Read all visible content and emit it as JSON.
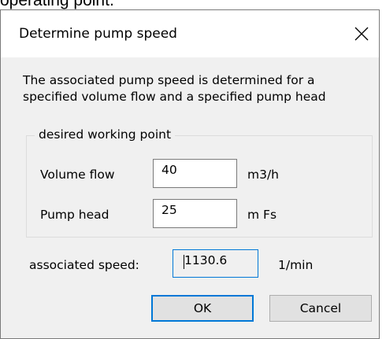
{
  "background_caption": "operating point.",
  "dialog": {
    "title": "Determine pump speed",
    "close_glyph": "close-x-icon",
    "description_line1": "The associated pump speed is determined for a",
    "description_line2": "specified volume flow and a specified pump head",
    "group": {
      "legend": "desired working point",
      "volume_flow": {
        "label": "Volume flow",
        "value": "40",
        "unit": "m3/h"
      },
      "pump_head": {
        "label": "Pump head",
        "value": "25",
        "unit": "m Fs"
      }
    },
    "speed": {
      "label": "associated speed:",
      "value": "1130.6",
      "unit": "1/min"
    },
    "buttons": {
      "ok": "OK",
      "cancel": "Cancel"
    }
  },
  "colors": {
    "dialog_background": "#f0f0f0",
    "titlebar_background": "#ffffff",
    "focus_accent": "#0078d7",
    "button_face": "#e1e1e1"
  }
}
